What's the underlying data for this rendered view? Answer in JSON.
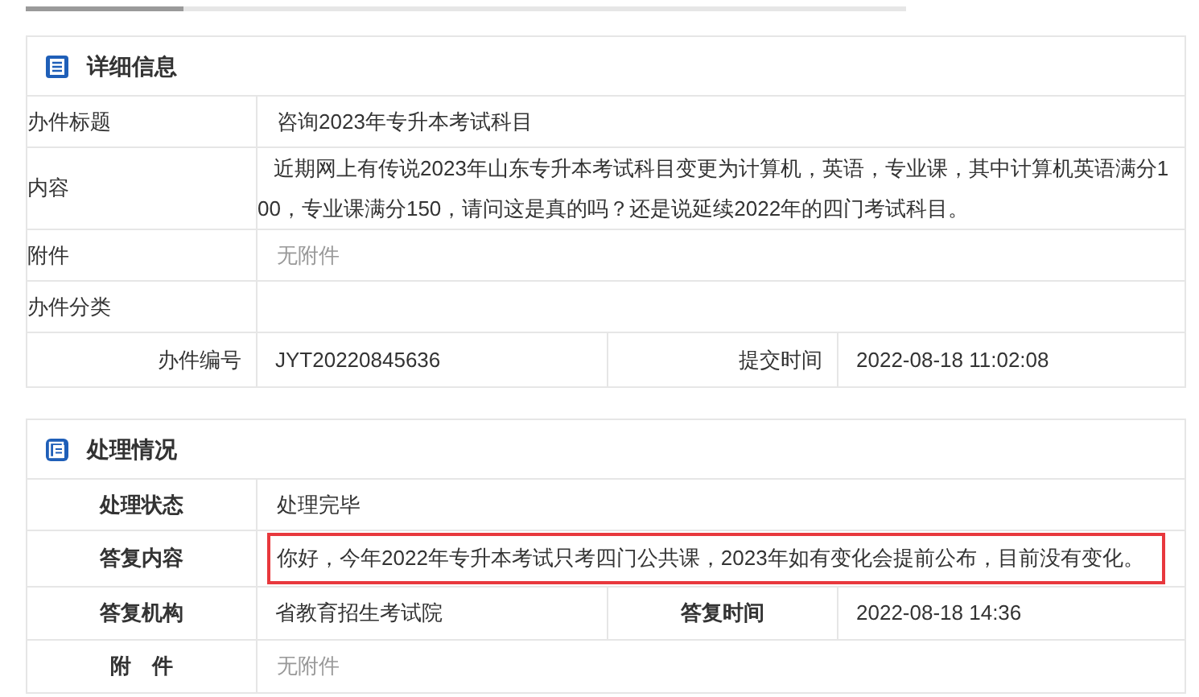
{
  "sections": [
    {
      "title": "详细信息",
      "rows": [
        {
          "kind": "wide",
          "label": "办件标题",
          "value": "咨询2023年专升本考试科目",
          "muted": false,
          "highlighted": false
        },
        {
          "kind": "paragraph",
          "label": "内容",
          "value": "近期网上有传说2023年山东专升本考试科目变更为计算机，英语，专业课，其中计算机英语满分100，专业课满分150，请问这是真的吗？还是说延续2022年的四门考试科目。",
          "muted": false,
          "highlighted": false
        },
        {
          "kind": "wide",
          "label": "附件",
          "value": "无附件",
          "muted": true,
          "highlighted": false
        },
        {
          "kind": "wide",
          "label": "办件分类",
          "value": "",
          "muted": false,
          "highlighted": false
        },
        {
          "kind": "split",
          "cells": [
            {
              "label": "办件编号",
              "value": "JYT20220845636"
            },
            {
              "label": "提交时间",
              "value": "2022-08-18 11:02:08"
            }
          ]
        }
      ]
    },
    {
      "title": "处理情况",
      "rows": [
        {
          "kind": "wide",
          "label": "处理状态",
          "value": "处理完毕",
          "muted": false,
          "highlighted": false
        },
        {
          "kind": "wide",
          "label": "答复内容",
          "value": "你好，今年2022年专升本考试只考四门公共课，2023年如有变化会提前公布，目前没有变化。",
          "muted": false,
          "highlighted": true
        },
        {
          "kind": "split",
          "cells": [
            {
              "label": "答复机构",
              "value": "省教育招生考试院"
            },
            {
              "label": "答复时间",
              "value": "2022-08-18 14:36"
            }
          ]
        },
        {
          "kind": "wide",
          "label": "附　件",
          "value": "无附件",
          "muted": true,
          "highlighted": false
        }
      ]
    }
  ]
}
